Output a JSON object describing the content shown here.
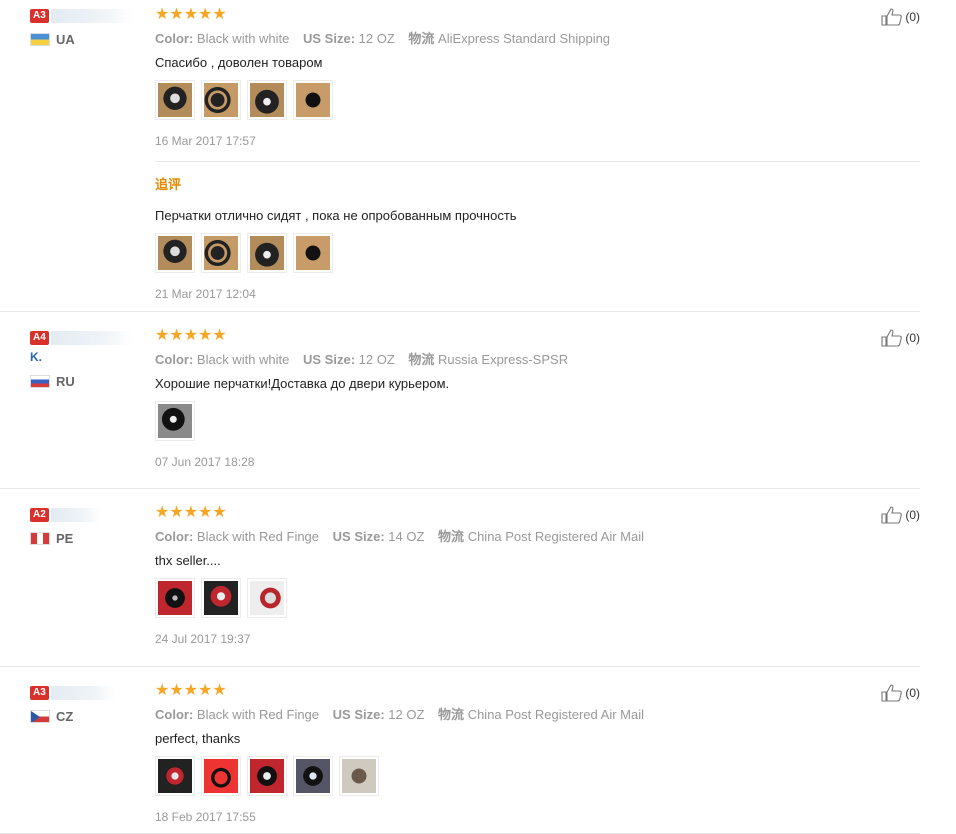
{
  "labels": {
    "color": "Color:",
    "size": "US Size:",
    "shipping": "物流",
    "followup": "追评"
  },
  "reviews": [
    {
      "level": "A3",
      "name_visible": "",
      "country": "UA",
      "color": "Black with white",
      "size": "12 OZ",
      "shipping": "AliExpress Standard Shipping",
      "text": "Спасибо , доволен товаром",
      "date": "16 Mar 2017 17:57",
      "likes": "(0)",
      "followup": {
        "text": "Перчатки отлично сидят , пока не опробованным прочность",
        "date": "21 Mar 2017 12:04"
      }
    },
    {
      "level": "A4",
      "name_visible": "K.",
      "country": "RU",
      "color": "Black with white",
      "size": "12 OZ",
      "shipping": "Russia Express-SPSR",
      "text": "Хорошие перчатки!Доставка до двери курьером.",
      "date": "07 Jun 2017 18:28",
      "likes": "(0)"
    },
    {
      "level": "A2",
      "name_visible": "",
      "country": "PE",
      "color": "Black with Red Finge",
      "size": "14 OZ",
      "shipping": "China Post Registered Air Mail",
      "text": "thx seller....",
      "date": "24 Jul 2017 19:37",
      "likes": "(0)"
    },
    {
      "level": "A3",
      "name_visible": "",
      "country": "CZ",
      "color": "Black with Red Finge",
      "size": "12 OZ",
      "shipping": "China Post Registered Air Mail",
      "text": "perfect, thanks",
      "date": "18 Feb 2017 17:55",
      "likes": "(0)"
    }
  ],
  "stars": "★★★★★",
  "colors": {
    "star": "#f5a623",
    "level_badge": "#d9302b",
    "followup": "#e08a00"
  }
}
